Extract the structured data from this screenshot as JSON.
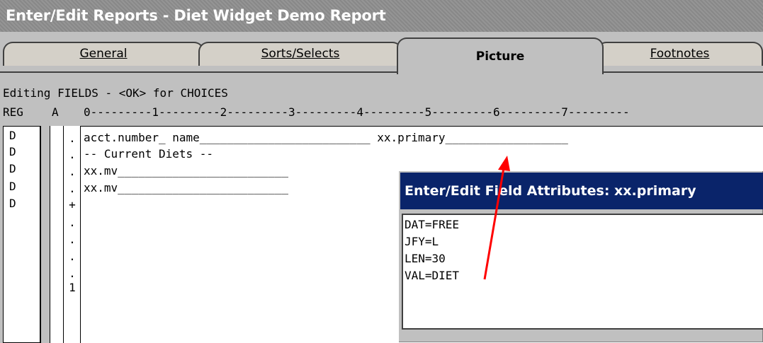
{
  "window": {
    "title": "Enter/Edit Reports - Diet Widget Demo Report"
  },
  "tabs": [
    {
      "label": "General",
      "active": false
    },
    {
      "label": "Sorts/Selects",
      "active": false
    },
    {
      "label": "Picture",
      "active": true
    },
    {
      "label": "Footnotes",
      "active": false
    }
  ],
  "editor": {
    "status": "Editing FIELDS - <OK> for CHOICES",
    "header_reg": "REG",
    "header_a": "A",
    "ruler": "0---------1---------2---------3---------4---------5---------6---------7---------",
    "reg_values": [
      "D",
      "D",
      "D",
      "D",
      "D"
    ],
    "dot_values": [
      ".",
      ".",
      ".",
      ".",
      "+",
      ".",
      ".",
      ".",
      ".",
      "1"
    ],
    "lines": [
      "acct.number_ name_________________________ xx.primary__________________",
      "-- Current Diets --",
      "xx.mv_________________________",
      "xx.mv_________________________"
    ]
  },
  "popup": {
    "title": "Enter/Edit Field Attributes: xx.primary",
    "attributes": [
      "DAT=FREE",
      "JFY=L",
      "LEN=30",
      "VAL=DIET"
    ]
  },
  "annotation": {
    "arrow_color": "#ff0000"
  }
}
